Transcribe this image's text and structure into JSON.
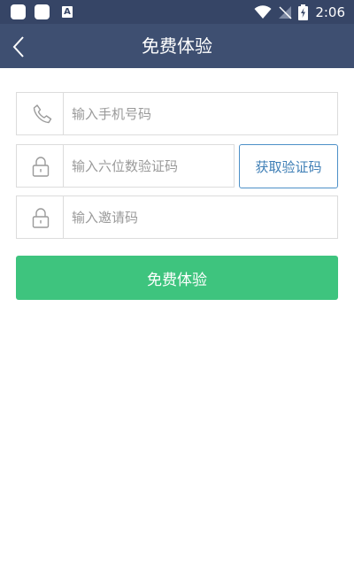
{
  "status_bar": {
    "time": "2:06",
    "icons": [
      "app-notification-icon",
      "app-notification-icon",
      "a-notification-icon",
      "wifi-icon",
      "signal-icon",
      "battery-charging-icon"
    ],
    "a_icon_text": "A"
  },
  "header": {
    "title": "免费体验",
    "back_icon": "chevron-left-icon"
  },
  "form": {
    "phone": {
      "icon": "phone-icon",
      "value": "",
      "placeholder": "输入手机号码"
    },
    "code": {
      "icon": "lock-icon",
      "value": "",
      "placeholder": "输入六位数验证码"
    },
    "invite": {
      "icon": "lock-icon",
      "value": "",
      "placeholder": "输入邀请码"
    },
    "get_code_label": "获取验证码",
    "submit_label": "免费体验"
  },
  "colors": {
    "status_bar_bg": "#364566",
    "nav_bar_bg": "#3e4f71",
    "accent_blue": "#4d90c8",
    "submit_green": "#3ec47e",
    "border_gray": "#dcdcdc"
  }
}
